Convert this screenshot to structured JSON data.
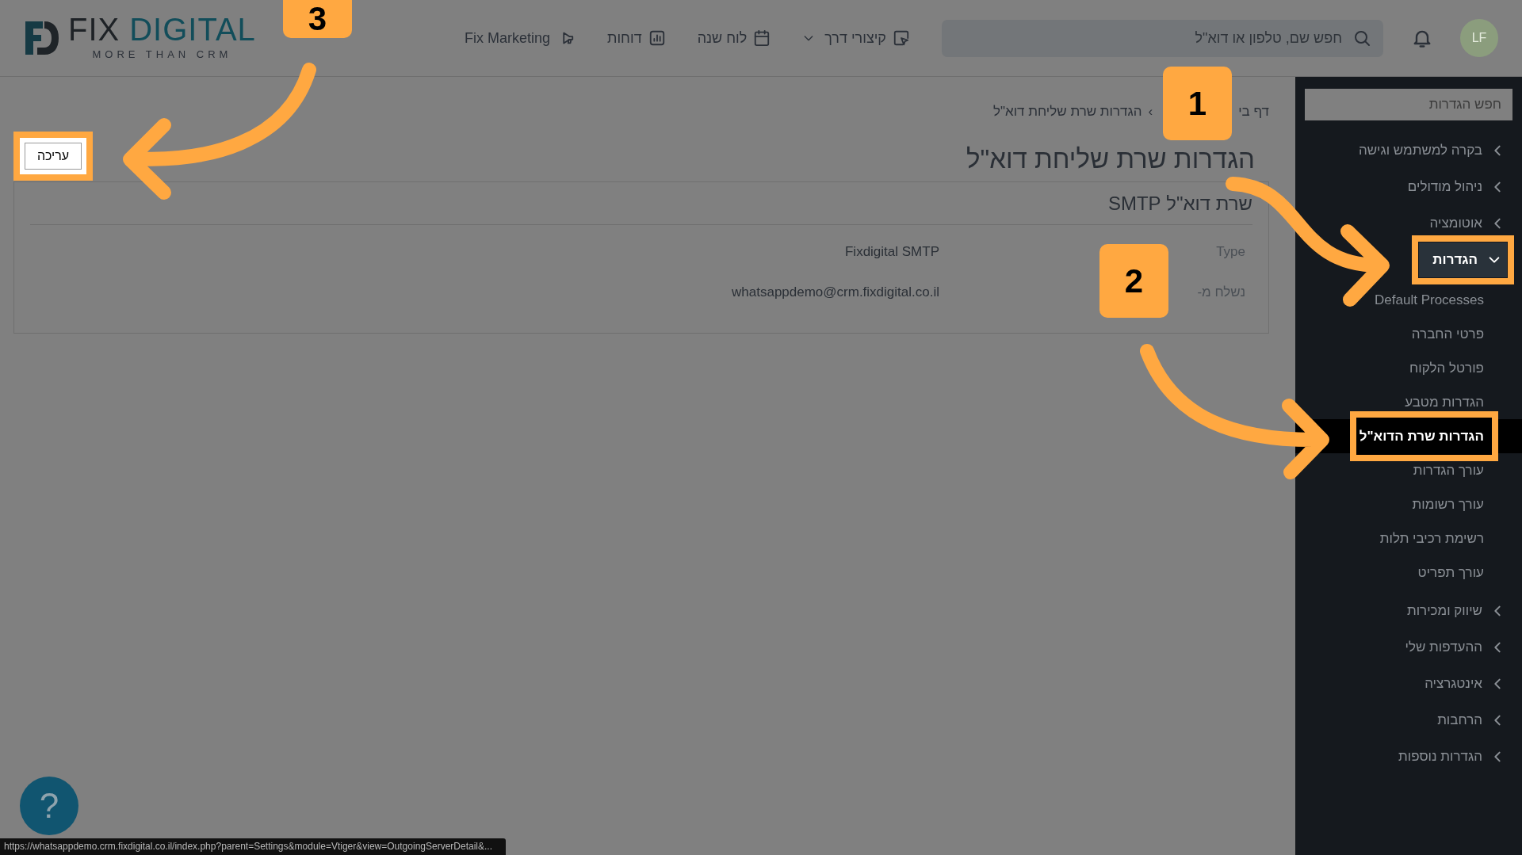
{
  "header": {
    "logo": {
      "word_1": "FIX",
      "word_2": "DIGITAL",
      "tagline": "MORE THAN CRM"
    },
    "nav": [
      {
        "label": "קיצורי דרך",
        "dropdown": true
      },
      {
        "label": "לוח שנה",
        "dropdown": false
      },
      {
        "label": "דוחות",
        "dropdown": false
      },
      {
        "label": "Fix Marketing",
        "dropdown": false
      }
    ],
    "search": {
      "placeholder": "חפש שם, טלפון או דוא\"ל"
    },
    "avatar": "LF"
  },
  "sidebar": {
    "search": {
      "placeholder": "חפש הגדרות"
    },
    "items": [
      {
        "label": "בקרה למשתמש וגישה",
        "expanded": false,
        "highlighted": false
      },
      {
        "label": "ניהול מודולים",
        "expanded": false,
        "highlighted": false
      },
      {
        "label": "אוטומציה",
        "expanded": false,
        "highlighted": false
      },
      {
        "label": "הגדרות",
        "expanded": true,
        "highlighted": true,
        "children": [
          {
            "label": "Default Processes",
            "selected": false,
            "highlighted": false
          },
          {
            "label": "פרטי החברה",
            "selected": false,
            "highlighted": false
          },
          {
            "label": "פורטל הלקוח",
            "selected": false,
            "highlighted": false
          },
          {
            "label": "הגדרות מטבע",
            "selected": false,
            "highlighted": false
          },
          {
            "label": "הגדרות שרת הדוא\"ל",
            "selected": true,
            "highlighted": true
          },
          {
            "label": "עורך הגדרות",
            "selected": false,
            "highlighted": false
          },
          {
            "label": "עורך רשומות",
            "selected": false,
            "highlighted": false
          },
          {
            "label": "רשימת רכיבי תלות",
            "selected": false,
            "highlighted": false
          },
          {
            "label": "עורך תפריט",
            "selected": false,
            "highlighted": false
          }
        ]
      },
      {
        "label": "שיווק ומכירות",
        "expanded": false,
        "highlighted": false
      },
      {
        "label": "ההעדפות שלי",
        "expanded": false,
        "highlighted": false
      },
      {
        "label": "אינטגרציה",
        "expanded": false,
        "highlighted": false
      },
      {
        "label": "הרחבות",
        "expanded": false,
        "highlighted": false
      },
      {
        "label": "הגדרות נוספות",
        "expanded": false,
        "highlighted": false
      }
    ]
  },
  "breadcrumb": {
    "items": [
      "דף בי",
      "הגדרות שרת שליחת דוא\"ל"
    ],
    "separator": "›"
  },
  "title": "הגדרות שרת שליחת דוא\"ל",
  "edit_button": {
    "label": "עריכה",
    "highlighted": true
  },
  "card": {
    "title": "שרת דוא\"ל SMTP",
    "rows": [
      {
        "label": "Type",
        "value": "Fixdigital SMTP"
      },
      {
        "label": "נשלח מ-",
        "value": "whatsappdemo@crm.fixdigital.co.il"
      }
    ]
  },
  "help_button": "?",
  "status_url": "https://whatsappdemo.crm.fixdigital.co.il/index.php?parent=Settings&module=Vtiger&view=OutgoingServerDetail&...",
  "callouts": [
    "1",
    "2",
    "3"
  ]
}
